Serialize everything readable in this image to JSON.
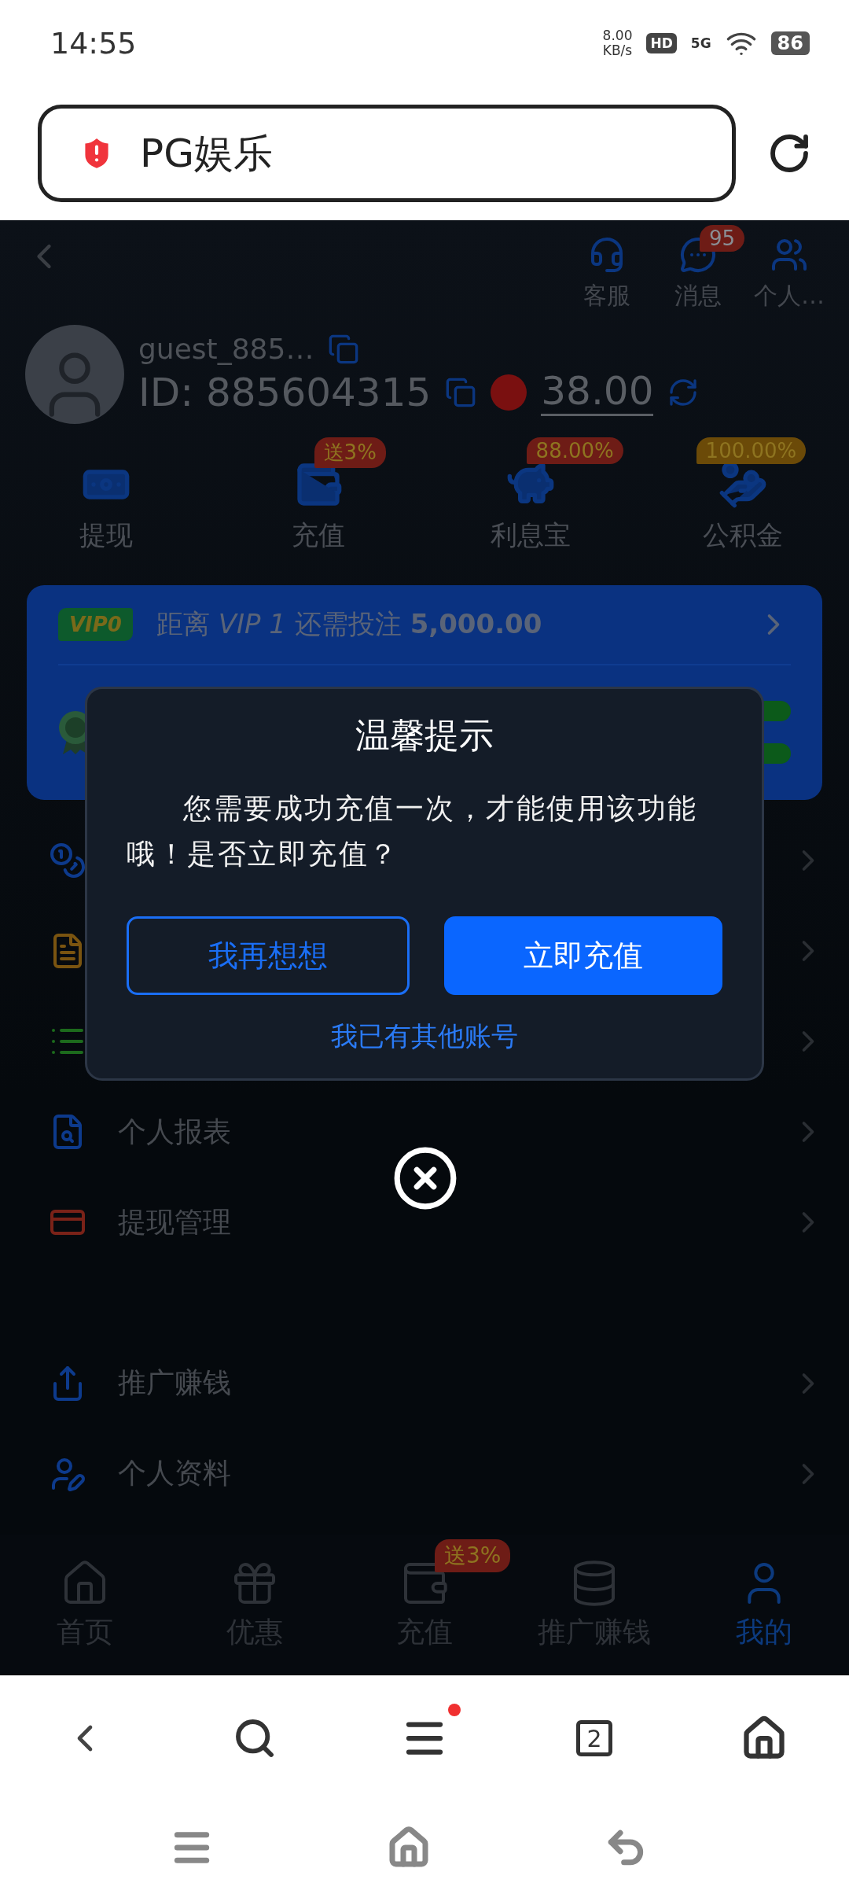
{
  "status_bar": {
    "time": "14:55",
    "net_speed": "8.00",
    "net_unit": "KB/s",
    "hd": "HD",
    "network": "5G",
    "battery": "86"
  },
  "browser": {
    "url": "PG娱乐"
  },
  "header": {
    "actions": [
      {
        "label": "客服",
        "kind": "support"
      },
      {
        "label": "消息",
        "kind": "message",
        "badge": "95"
      },
      {
        "label": "个人…",
        "kind": "person"
      }
    ]
  },
  "profile": {
    "username": "guest_885…",
    "id_label": "ID: 885604315",
    "balance": "38.00"
  },
  "quick_actions": [
    {
      "label": "提现",
      "kind": "withdraw"
    },
    {
      "label": "充值",
      "kind": "wallet",
      "badge": "送3%",
      "color": "#6e1c16"
    },
    {
      "label": "利息宝",
      "kind": "piggy",
      "badge": "88.00%",
      "color": "#6e1c16"
    },
    {
      "label": "公积金",
      "kind": "fund",
      "badge": "100.00%",
      "color": "#6b4a08"
    }
  ],
  "vip": {
    "level": "VIP0",
    "text": "距离 *VIP 1* 还需投注 **5,000.00**"
  },
  "menu": {
    "sections": [
      {
        "items": [
          {
            "kind": "coin",
            "color": "#0d3a8c"
          },
          {
            "kind": "bill",
            "color": "#7a5410"
          },
          {
            "kind": "list",
            "color": "#1c6a1c"
          },
          {
            "kind": "report",
            "label": "个人报表",
            "color": "#0d3a8c"
          },
          {
            "kind": "card",
            "label": "提现管理",
            "color": "#7a2218"
          }
        ]
      },
      {
        "items": [
          {
            "kind": "share",
            "label": "推广赚钱",
            "color": "#0d3a8c"
          },
          {
            "kind": "profile",
            "label": "个人资料",
            "color": "#0d3a8c"
          }
        ]
      }
    ]
  },
  "dialog": {
    "title": "温馨提示",
    "message": "您需要成功充值一次，才能使用该功能哦！是否立即充值？",
    "cancel": "我再想想",
    "confirm": "立即充值",
    "link": "我已有其他账号"
  },
  "bottom_nav": [
    {
      "label": "首页",
      "kind": "home",
      "selected": false
    },
    {
      "label": "优惠",
      "kind": "gift",
      "selected": false
    },
    {
      "label": "充值",
      "kind": "wallet",
      "selected": false,
      "badge": "送3%"
    },
    {
      "label": "推广赚钱",
      "kind": "promote",
      "selected": false
    },
    {
      "label": "我的",
      "kind": "user",
      "selected": true
    }
  ],
  "browser_toolbar": {
    "tabs_count": "2",
    "menu_notification": true
  }
}
